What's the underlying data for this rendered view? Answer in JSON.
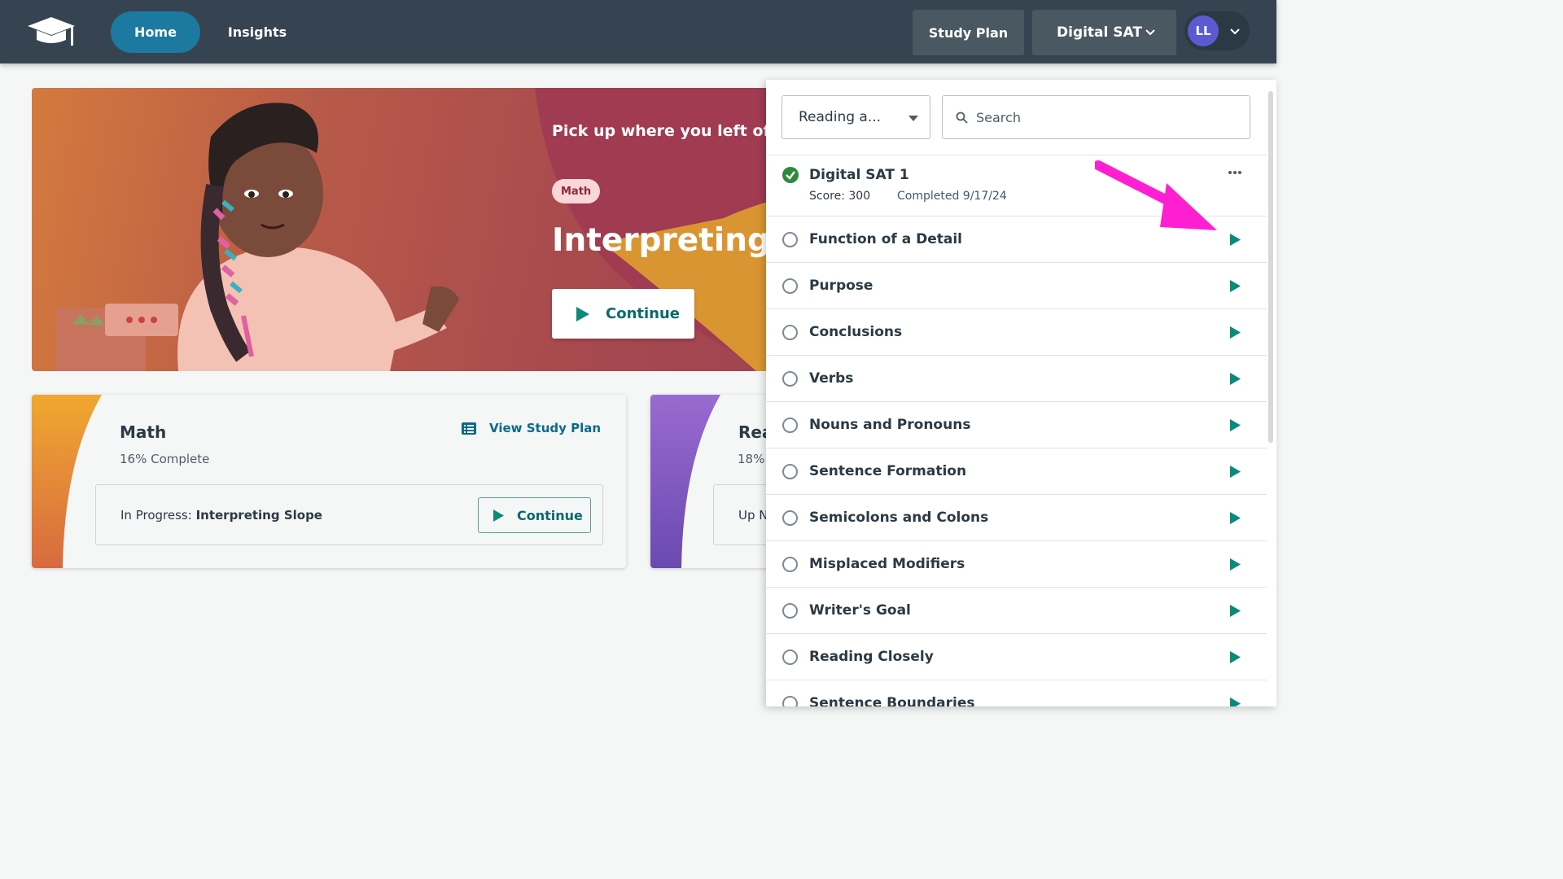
{
  "nav": {
    "home": "Home",
    "insights": "Insights",
    "study_plan": "Study Plan",
    "course": "Digital SAT",
    "avatar_initials": "LL"
  },
  "hero": {
    "heading": "Pick up where you left off...",
    "chip": "Math",
    "topic": "Interpreting Sl",
    "continue": "Continue"
  },
  "math_card": {
    "title": "Math",
    "percent": "16% Complete",
    "view_plan": "View Study Plan",
    "progress_prefix": "In Progress:",
    "progress_topic": "Interpreting Slope",
    "continue": "Continue"
  },
  "reading_card": {
    "title": "Rea",
    "percent": "18%",
    "upnext": "Up N"
  },
  "panel": {
    "select_value": "Reading a...",
    "search_placeholder": "Search",
    "completed_item": {
      "name": "Digital SAT 1",
      "score": "Score: 300",
      "completed": "Completed 9/17/24"
    },
    "items": [
      "Function of a Detail",
      "Purpose",
      "Conclusions",
      "Verbs",
      "Nouns and Pronouns",
      "Sentence Formation",
      "Semicolons and Colons",
      "Misplaced Modifiers",
      "Writer's Goal",
      "Reading Closely",
      "Sentence Boundaries"
    ]
  },
  "colors": {
    "nav_bg": "#354450",
    "accent_teal": "#0b8a7a",
    "home_pill": "#1c7aa0",
    "arrow_magenta": "#ff1fd3"
  }
}
